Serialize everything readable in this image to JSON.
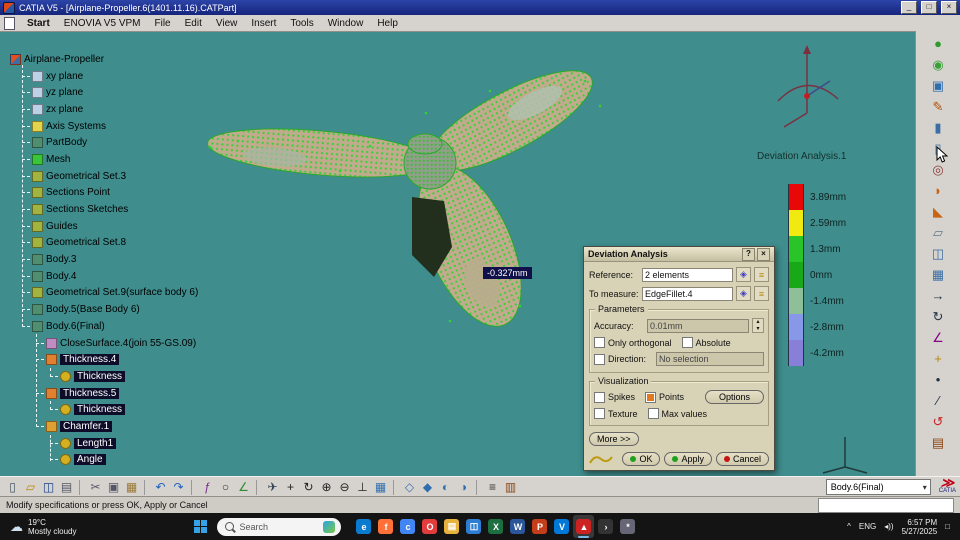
{
  "titlebar": {
    "title": "CATIA V5 - [Airplane-Propeller.6(1401.11.16).CATPart]",
    "minimize": "_",
    "maximize": "□",
    "close": "×"
  },
  "menubar": {
    "items": [
      "Start",
      "ENOVIA V5 VPM",
      "File",
      "Edit",
      "View",
      "Insert",
      "Tools",
      "Window",
      "Help"
    ]
  },
  "tree": {
    "items": [
      {
        "label": "Airplane-Propeller",
        "level": 0,
        "icon": "part",
        "highlighted": false
      },
      {
        "label": "xy plane",
        "level": 1,
        "icon": "plane",
        "highlighted": false
      },
      {
        "label": "yz plane",
        "level": 1,
        "icon": "plane",
        "highlighted": false
      },
      {
        "label": "zx plane",
        "level": 1,
        "icon": "plane",
        "highlighted": false
      },
      {
        "label": "Axis Systems",
        "level": 1,
        "icon": "axis",
        "highlighted": false
      },
      {
        "label": "PartBody",
        "level": 1,
        "icon": "body",
        "highlighted": false
      },
      {
        "label": "Mesh",
        "level": 1,
        "icon": "mesh",
        "highlighted": false
      },
      {
        "label": "Geometrical Set.3",
        "level": 1,
        "icon": "geoset",
        "highlighted": false
      },
      {
        "label": "Sections Point",
        "level": 1,
        "icon": "geoset",
        "highlighted": false
      },
      {
        "label": "Sections Sketches",
        "level": 1,
        "icon": "geoset",
        "highlighted": false
      },
      {
        "label": "Guides",
        "level": 1,
        "icon": "geoset",
        "highlighted": false
      },
      {
        "label": "Geometrical Set.8",
        "level": 1,
        "icon": "geoset",
        "highlighted": false
      },
      {
        "label": "Body.3",
        "level": 1,
        "icon": "body",
        "highlighted": false
      },
      {
        "label": "Body.4",
        "level": 1,
        "icon": "body",
        "highlighted": false
      },
      {
        "label": "Geometrical Set.9(surface body 6)",
        "level": 1,
        "icon": "geoset",
        "highlighted": false
      },
      {
        "label": "Body.5(Base Body 6)",
        "level": 1,
        "icon": "body",
        "highlighted": false
      },
      {
        "label": "Body.6(Final)",
        "level": 1,
        "icon": "body",
        "highlighted": false
      },
      {
        "label": "CloseSurface.4(join 55-GS.09)",
        "level": 2,
        "icon": "closesurface",
        "highlighted": false
      },
      {
        "label": "Thickness.4",
        "level": 2,
        "icon": "thickness",
        "highlighted": true
      },
      {
        "label": "Thickness",
        "level": 3,
        "icon": "param",
        "highlighted": true
      },
      {
        "label": "Thickness.5",
        "level": 2,
        "icon": "thickness",
        "highlighted": true
      },
      {
        "label": "Thickness",
        "level": 3,
        "icon": "param",
        "highlighted": true
      },
      {
        "label": "Chamfer.1",
        "level": 2,
        "icon": "chamfer",
        "highlighted": true
      },
      {
        "label": "Length1",
        "level": 3,
        "icon": "param",
        "highlighted": true
      },
      {
        "label": "Angle",
        "level": 3,
        "icon": "param",
        "highlighted": true
      }
    ]
  },
  "viewport": {
    "analysis_title": "Deviation Analysis.1",
    "measurement_label": "-0.327mm",
    "scale": [
      {
        "label": "3.89mm",
        "color": "#e80808"
      },
      {
        "label": "2.59mm",
        "color": "#f0ea10"
      },
      {
        "label": "1.3mm",
        "color": "#28c428"
      },
      {
        "label": "0mm",
        "color": "#18a818"
      },
      {
        "label": "-1.4mm",
        "color": "#8fbf98"
      },
      {
        "label": "-2.8mm",
        "color": "#8898e8"
      },
      {
        "label": "-4.2mm",
        "color": "#8880d8"
      }
    ]
  },
  "dialog": {
    "title": "Deviation Analysis",
    "help": "?",
    "close": "×",
    "reference_label": "Reference:",
    "reference_value": "2 elements",
    "to_measure_label": "To measure:",
    "to_measure_value": "EdgeFillet.4",
    "parameters_title": "Parameters",
    "accuracy_label": "Accuracy:",
    "accuracy_value": "0.01mm",
    "only_orthogonal_label": "Only orthogonal",
    "absolute_label": "Absolute",
    "direction_label": "Direction:",
    "direction_value": "No selection",
    "visualization_title": "Visualization",
    "spikes_label": "Spikes",
    "points_label": "Points",
    "options_label": "Options",
    "texture_label": "Texture",
    "max_values_label": "Max values",
    "more_label": "More >>",
    "ok_label": "OK",
    "apply_label": "Apply",
    "cancel_label": "Cancel",
    "checks": {
      "only_orthogonal": false,
      "absolute": false,
      "direction": false,
      "spikes": false,
      "points": true,
      "texture": false,
      "max_values": false
    }
  },
  "right_toolbar": {
    "icons": [
      {
        "name": "deviation-analysis-icon",
        "glyph": "●",
        "color": "#2e9b2e"
      },
      {
        "name": "shaded-analysis-icon",
        "glyph": "◉",
        "color": "#3aa03a"
      },
      {
        "name": "view-mode-icon",
        "glyph": "▣",
        "color": "#2f6fb0"
      },
      {
        "name": "sketch-icon",
        "glyph": "✎",
        "color": "#b05010"
      },
      {
        "name": "pad-icon",
        "glyph": "▮",
        "color": "#3a6ea5"
      },
      {
        "name": "pocket-icon",
        "glyph": "▯",
        "color": "#3a6ea5"
      },
      {
        "name": "shaft-icon",
        "glyph": "◎",
        "color": "#8b3a3a"
      },
      {
        "name": "fillet-icon",
        "glyph": "◗",
        "color": "#c86414"
      },
      {
        "name": "chamfer-icon",
        "glyph": "◣",
        "color": "#c86414"
      },
      {
        "name": "plane-icon",
        "glyph": "▱",
        "color": "#667788"
      },
      {
        "name": "mirror-icon",
        "glyph": "◫",
        "color": "#3a6ea5"
      },
      {
        "name": "pattern-icon",
        "glyph": "▦",
        "color": "#3a6ea5"
      },
      {
        "name": "translate-icon",
        "glyph": "→",
        "color": "#223344"
      },
      {
        "name": "rotate-icon",
        "glyph": "↻",
        "color": "#223344"
      },
      {
        "name": "measure-angle-icon",
        "glyph": "∠",
        "color": "#8b008b"
      },
      {
        "name": "axis-icon",
        "glyph": "+",
        "color": "#b8860b"
      },
      {
        "name": "point-icon",
        "glyph": "•",
        "color": "#223344"
      },
      {
        "name": "line-icon",
        "glyph": "∕",
        "color": "#223344"
      },
      {
        "name": "update-icon",
        "glyph": "↺",
        "color": "#cc2222"
      },
      {
        "name": "catalog-tool-icon",
        "glyph": "▤",
        "color": "#8b4513"
      }
    ]
  },
  "bottom_toolbar": {
    "doc_selector": "Body.6(Final)",
    "logo_text": "CATIA",
    "icons": [
      {
        "name": "new-document-icon",
        "glyph": "▯",
        "color": "#445566"
      },
      {
        "name": "open-folder-icon",
        "glyph": "▱",
        "color": "#b8860b"
      },
      {
        "name": "save-icon",
        "glyph": "◫",
        "color": "#16418c"
      },
      {
        "name": "print-icon",
        "glyph": "▤",
        "color": "#555566"
      },
      {
        "sep": true
      },
      {
        "name": "cut-icon",
        "glyph": "✂",
        "color": "#555566"
      },
      {
        "name": "copy-icon",
        "glyph": "▣",
        "color": "#555566"
      },
      {
        "name": "paste-icon",
        "glyph": "▦",
        "color": "#997733"
      },
      {
        "sep": true
      },
      {
        "name": "undo-icon",
        "glyph": "↶",
        "color": "#1f5fbf"
      },
      {
        "name": "redo-icon",
        "glyph": "↷",
        "color": "#1f5fbf"
      },
      {
        "sep": true
      },
      {
        "name": "fx-icon",
        "glyph": "ƒ",
        "color": "#7a2f8f"
      },
      {
        "name": "knowledge-search-icon",
        "glyph": "○",
        "color": "#333333"
      },
      {
        "name": "measure-icon",
        "glyph": "∠",
        "color": "#2e8b2e"
      },
      {
        "sep": true
      },
      {
        "name": "fly-mode-icon",
        "glyph": "✈",
        "color": "#334455"
      },
      {
        "name": "pan-icon",
        "glyph": "+",
        "color": "#222222"
      },
      {
        "name": "rotate-view-icon",
        "glyph": "↻",
        "color": "#222222"
      },
      {
        "name": "zoom-in-icon",
        "glyph": "⊕",
        "color": "#222222"
      },
      {
        "name": "zoom-out-icon",
        "glyph": "⊖",
        "color": "#222222"
      },
      {
        "name": "normal-view-icon",
        "glyph": "⊥",
        "color": "#222222"
      },
      {
        "name": "multi-view-icon",
        "glyph": "▦",
        "color": "#2f6fb0"
      },
      {
        "sep": true
      },
      {
        "name": "wireframe-icon",
        "glyph": "◇",
        "color": "#2f6fb0"
      },
      {
        "name": "shading-icon",
        "glyph": "◆",
        "color": "#2f6fb0"
      },
      {
        "name": "hide-show-icon",
        "glyph": "◐",
        "color": "#2f6fb0"
      },
      {
        "name": "swap-visible-icon",
        "glyph": "◑",
        "color": "#2f6fb0"
      },
      {
        "sep": true
      },
      {
        "name": "tree-graph-icon",
        "glyph": "≡",
        "color": "#333333"
      },
      {
        "name": "catalog-icon",
        "glyph": "▥",
        "color": "#8b4513"
      }
    ]
  },
  "statusbar": {
    "message": "Modify specifications or press OK, Apply or Cancel"
  },
  "taskbar": {
    "weather_temp": "19°C",
    "weather_desc": "Mostly cloudy",
    "search_label": "Search",
    "apps": [
      {
        "name": "app-icon-edge",
        "glyph": "e",
        "color": "#0b7bd0"
      },
      {
        "name": "app-icon-firefox",
        "glyph": "f",
        "color": "#ff7139"
      },
      {
        "name": "app-icon-chrome",
        "glyph": "c",
        "color": "#4285f4"
      },
      {
        "name": "app-icon-opera",
        "glyph": "O",
        "color": "#e23c3c"
      },
      {
        "name": "app-icon-explorer",
        "glyph": "▤",
        "color": "#e8b33c"
      },
      {
        "name": "app-icon-store",
        "glyph": "◫",
        "color": "#2d7dd2"
      },
      {
        "name": "app-icon-excel",
        "glyph": "X",
        "color": "#1d6f42"
      },
      {
        "name": "app-icon-word",
        "glyph": "W",
        "color": "#2b579a"
      },
      {
        "name": "app-icon-powerpoint",
        "glyph": "P",
        "color": "#c43e1c"
      },
      {
        "name": "app-icon-vscode",
        "glyph": "V",
        "color": "#0078d7"
      },
      {
        "name": "app-icon-catia",
        "glyph": "▲",
        "color": "#cc2222",
        "active": true
      },
      {
        "name": "app-icon-terminal",
        "glyph": "›",
        "color": "#333333"
      },
      {
        "name": "app-icon-settings",
        "glyph": "*",
        "color": "#666677"
      }
    ],
    "tray": {
      "chevron": "^",
      "lang": "ENG",
      "volume": "◂))",
      "time": "6:57 PM",
      "date": "5/27/2025",
      "notif": "□"
    }
  }
}
